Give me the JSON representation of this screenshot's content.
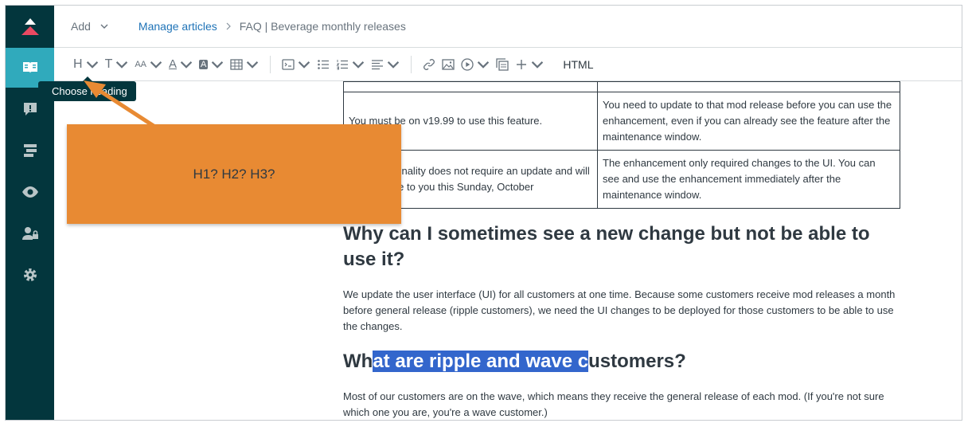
{
  "header": {
    "add_label": "Add",
    "breadcrumb": {
      "link": "Manage articles",
      "current": "FAQ | Beverage monthly releases"
    }
  },
  "toolbar": {
    "heading_label": "H",
    "text_label": "T",
    "fontsize_label": "AA",
    "fontcolor_label": "A",
    "bgcolor_label": "A",
    "html_label": "HTML"
  },
  "tooltip": {
    "text": "Choose heading"
  },
  "callout": {
    "text": "H1? H2? H3?"
  },
  "table": {
    "rows": [
      {
        "left": "You must be on v19.99 to use this feature.",
        "right": "You need to update to that mod release before you can use the enhancement, even if you can already see the feature after the maintenance window."
      },
      {
        "left": "This functionality does not require an update and will be available to you this Sunday, October",
        "right": "The enhancement only required changes to the UI.  You can see and use the enhancement immediately after the maintenance window."
      }
    ]
  },
  "article": {
    "heading1": "Why can I sometimes see a new change but not be able to use it?",
    "para1": "We update the user interface (UI) for all customers at one time. Because some customers receive mod releases a month before general release (ripple customers), we need the UI changes to be deployed for those customers to be able to use the changes.",
    "heading2_pre": "Wh",
    "heading2_sel": "at are ripple and wave c",
    "heading2_post": "ustomers?",
    "para2": "Most of our customers are on the wave, which means they receive the general release of each mod. (If you're not sure which one you are, you're a wave customer.)"
  },
  "colors": {
    "sidebar": "#03363d",
    "active": "#30aabc",
    "callout": "#e88a33",
    "selection": "#3366cc"
  }
}
